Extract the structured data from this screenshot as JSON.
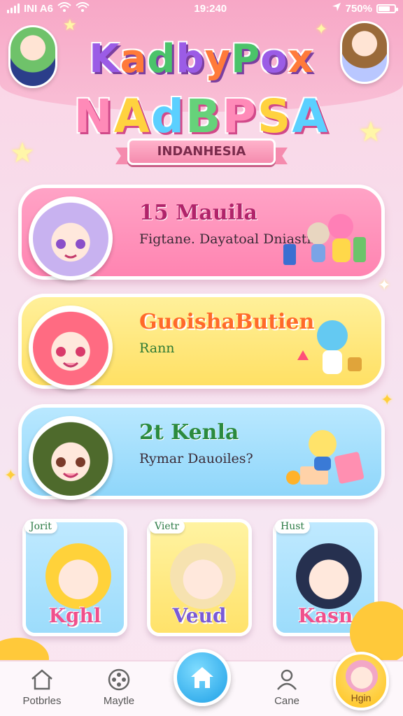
{
  "status_bar": {
    "carrier": "INI A6",
    "time": "19:240",
    "battery": "750%",
    "battery_level": 0.75
  },
  "header": {
    "title_chars": [
      "K",
      "a",
      "d",
      "b",
      "y",
      "P",
      "o",
      "x"
    ],
    "subtitle_chars": [
      "N",
      "A",
      "d",
      "B",
      "P",
      "S",
      "A"
    ],
    "ribbon": "INDANHESIA"
  },
  "cards": [
    {
      "title": "15 Mauila",
      "subtitle": "Figtane. Dayatoal Dniastn",
      "color": "#ff8ab4"
    },
    {
      "title": "GuoishaButien",
      "subtitle": "Rann",
      "color": "#ffe46e"
    },
    {
      "title": "2t Kenla",
      "subtitle": "Rymar Dauoiles?",
      "color": "#9fd9fb"
    }
  ],
  "tiles": [
    {
      "bubble": "Jorit",
      "label": "Kghl"
    },
    {
      "bubble": "Vietr",
      "label": "Veud"
    },
    {
      "bubble": "Hust",
      "label": "Kasn"
    }
  ],
  "bottom_nav": {
    "items": [
      {
        "label": "Potbrles",
        "icon": "house-outline-icon"
      },
      {
        "label": "Maytle",
        "icon": "film-reel-icon"
      },
      {
        "label": "",
        "icon": "home-icon"
      },
      {
        "label": "Cane",
        "icon": "person-icon"
      },
      {
        "label": "Hgin",
        "icon": "profile-avatar-icon"
      }
    ]
  },
  "colors": {
    "accent_blue": "#1d9fe6",
    "pink": "#ff84b1",
    "yellow": "#ffe064",
    "light_blue": "#8fd6fa"
  }
}
